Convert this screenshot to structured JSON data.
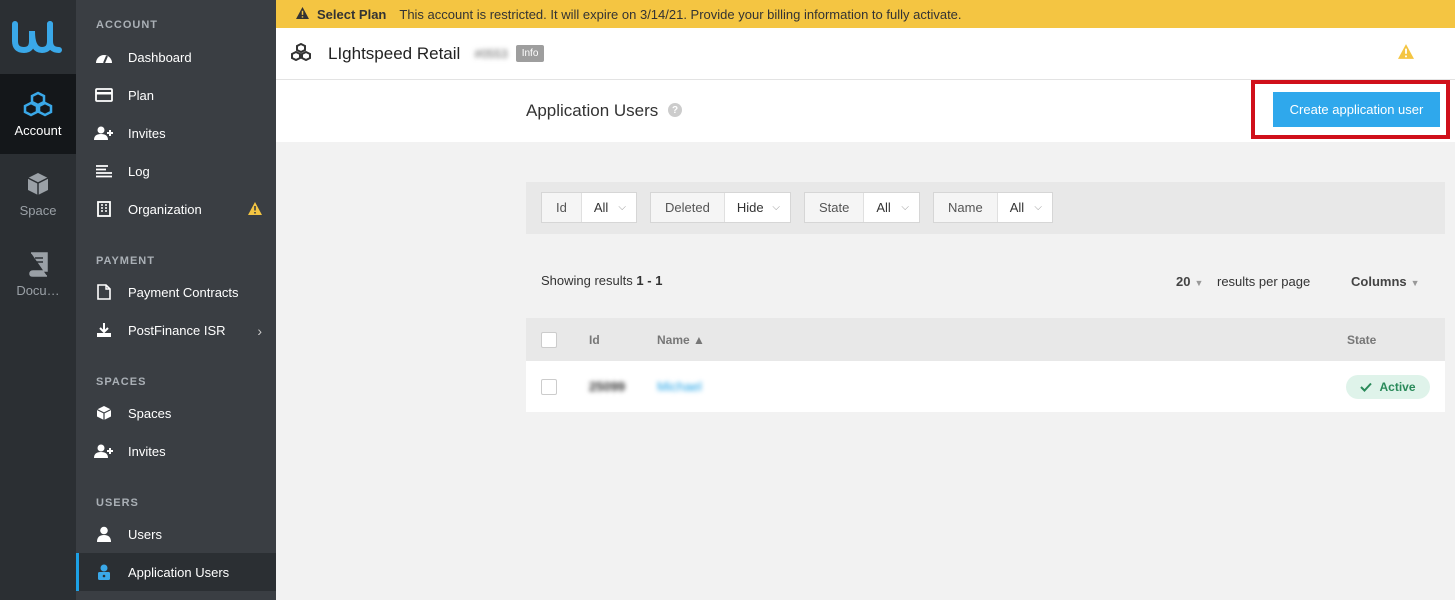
{
  "rail": {
    "items": [
      {
        "label": "Account",
        "icon": "cubes-icon",
        "active": true
      },
      {
        "label": "Space",
        "icon": "cube-icon"
      },
      {
        "label": "Docu…",
        "icon": "book-icon"
      }
    ]
  },
  "nav": {
    "sections": {
      "account": "ACCOUNT",
      "payment": "PAYMENT",
      "spaces": "SPACES",
      "users": "USERS"
    },
    "items": {
      "dashboard": "Dashboard",
      "plan": "Plan",
      "invites": "Invites",
      "log": "Log",
      "organization": "Organization",
      "payment_contracts": "Payment Contracts",
      "postfinance": "PostFinance ISR",
      "spaces": "Spaces",
      "space_invites": "Invites",
      "users": "Users",
      "application_users": "Application Users"
    }
  },
  "banner": {
    "title": "Select Plan",
    "message": "This account is restricted. It will expire on 3/14/21. Provide your billing information to fully activate."
  },
  "topbar": {
    "title": "LIghtspeed Retail",
    "account_id": "#0553",
    "badge": "Info"
  },
  "page": {
    "title": "Application Users",
    "help": "?",
    "create_button": "Create application user"
  },
  "filters": [
    {
      "key": "Id",
      "value": "All"
    },
    {
      "key": "Deleted",
      "value": "Hide"
    },
    {
      "key": "State",
      "value": "All"
    },
    {
      "key": "Name",
      "value": "All"
    }
  ],
  "results": {
    "prefix": "Showing results",
    "range": "1 - 1",
    "per_page": "20",
    "per_page_label": "results per page",
    "columns": "Columns"
  },
  "table": {
    "headers": {
      "id": "Id",
      "name": "Name ▲",
      "state": "State"
    },
    "rows": [
      {
        "id": "25099",
        "name": "Michael",
        "state": "Active"
      }
    ]
  },
  "colors": {
    "accent": "#2fa8ec",
    "banner": "#f4c542",
    "highlight": "#d0101a",
    "active_status": "#2a8a5a"
  }
}
